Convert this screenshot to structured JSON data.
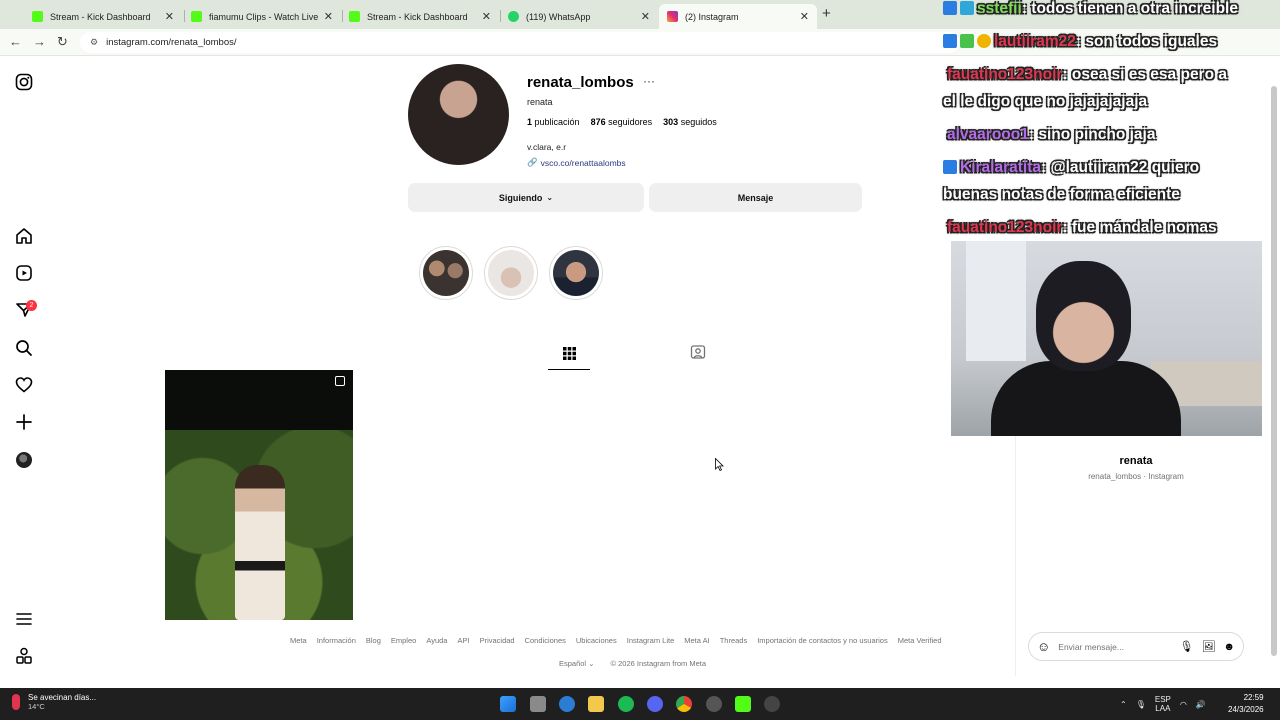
{
  "browser": {
    "tabs": [
      {
        "title": "Stream - Kick Dashboard",
        "color": "#53fc18",
        "active": false
      },
      {
        "title": "fiamumu Clips - Watch Live on",
        "color": "#53fc18",
        "active": false
      },
      {
        "title": "Stream - Kick Dashboard",
        "color": "#53fc18",
        "active": false
      },
      {
        "title": "(119) WhatsApp",
        "color": "#25d366",
        "active": false
      },
      {
        "title": "(2) Instagram",
        "color": "#e1306c",
        "active": true
      }
    ],
    "new_tab_icon": "plus-icon",
    "url": "instagram.com/renata_lombos/"
  },
  "sidebar": {
    "notification_count": "2"
  },
  "profile": {
    "username": "renata_lombos",
    "full_name": "renata",
    "stats": [
      {
        "value": "1",
        "label": "publicación"
      },
      {
        "value": "876",
        "label": "seguidores"
      },
      {
        "value": "303",
        "label": "seguidos"
      }
    ],
    "bio": "v.clara, e.r",
    "link": "vsco.co/renattaalombs",
    "following_button": "Siguiendo",
    "message_button": "Mensaje"
  },
  "footer": {
    "links": [
      "Meta",
      "Información",
      "Blog",
      "Empleo",
      "Ayuda",
      "API",
      "Privacidad",
      "Condiciones",
      "Ubicaciones",
      "Instagram Lite",
      "Meta AI",
      "Threads",
      "Importación de contactos y no usuarios",
      "Meta Verified"
    ],
    "language": "Español",
    "copyright": "© 2026 Instagram from Meta"
  },
  "stream_chat": [
    {
      "user": "sstefii",
      "user_color": "#7fdc5a",
      "text": ": todos tienen a otra increible"
    },
    {
      "user": "lautiiram22",
      "user_color": "#e0354f",
      "text": ": son todos iguales"
    },
    {
      "user": "fauatino123noir",
      "user_color": "#e0354f",
      "text": ": osea si es esa pero a"
    },
    {
      "user": "",
      "user_color": "#ffffff",
      "text": "el le digo que no jajajajajaja"
    },
    {
      "user": "alvaarooo1",
      "user_color": "#b36be8",
      "text": ": sino pincho jaja"
    },
    {
      "user": "Kiralaratita",
      "user_color": "#b36be8",
      "text": ": @lautiiram22 quiero"
    },
    {
      "user": "",
      "user_color": "#ffffff",
      "text": "buenas notas de forma eficiente"
    },
    {
      "user": "fauatino123noir",
      "user_color": "#e0354f",
      "text": ": fue mándale nomas"
    }
  ],
  "dm_panel": {
    "name": "renata",
    "subtitle": "renata_lombos · Instagram",
    "input_placeholder": "Enviar mensaje..."
  },
  "taskbar": {
    "weather_title": "Se avecinan días...",
    "weather_temp": "14°C",
    "language": "ESP",
    "layout": "LAA",
    "time": "22:59",
    "date": "24/3/2026"
  }
}
